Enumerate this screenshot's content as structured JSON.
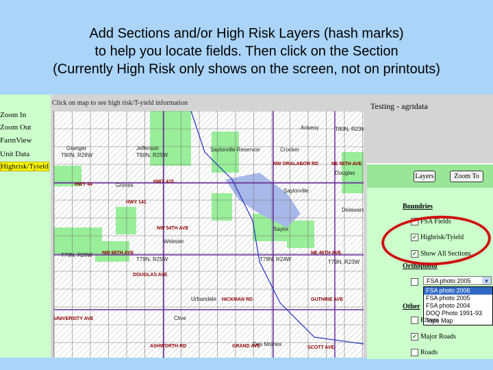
{
  "slide": {
    "title_lines": [
      "Add Sections and/or High Risk Layers (hash marks)",
      "to help you locate fields. Then click on the Section",
      "(Currently High Risk only shows on the screen, not on printouts)"
    ]
  },
  "left_menu": {
    "items": [
      {
        "label": "Zoom In"
      },
      {
        "label": "Zoom Out"
      },
      {
        "label": "FarmView"
      },
      {
        "label": "Unit Data"
      },
      {
        "label": "Highrisk/Tyield",
        "selected": true
      }
    ]
  },
  "map": {
    "header": "Click on map to see high risk/T-yield information",
    "towns": [
      "Ankeny",
      "Granger",
      "T80N, R26W",
      "Jefferson",
      "T80N, R25W",
      "Saylorville Reservoir",
      "Crocker",
      "Douglas",
      "Saylorville",
      "Delaware",
      "Saylor",
      "Webster",
      "T79N, R26W",
      "T79N, R25W",
      "T79N, R24W",
      "T79N, R23W",
      "Urbandale",
      "Clive",
      "Des Moines",
      "Grimes",
      "T80N, R23W"
    ],
    "roads": [
      "NW 54TH AVE",
      "HWY 141",
      "NW 66TH AVE",
      "DOUGLAS AVE",
      "HICKMAN RD",
      "UNIVERSITY AVE",
      "ASHWORTH RD",
      "GRAND AVE",
      "SCOTT AVE",
      "GUTHRIE AVE",
      "NE 46TH AVE",
      "NW ORALABOR RD",
      "NE 56TH AVE",
      "HWY 44",
      "HWY 415"
    ],
    "colors": {
      "park": "#99ee99",
      "water": "#a8b8e8",
      "grid": "#777777",
      "road": "#8b0000"
    }
  },
  "right_panel": {
    "title": "Testing - agridata",
    "buttons": {
      "layers": "Layers",
      "zoom_to": "Zoom To"
    },
    "boundaries": {
      "heading": "Boundries",
      "items": [
        {
          "label": "FSA Fields",
          "checked": false
        },
        {
          "label": "Highrisk/Tyield",
          "checked": true
        },
        {
          "label": "Show All Sections",
          "checked": true
        }
      ]
    },
    "orthophotos": {
      "heading": "Orthophoto",
      "checked": false,
      "selected": "FSA photo 2005",
      "options": [
        "FSA photo 2006",
        "FSA photo 2005",
        "FSA photo 2004",
        "DOQ Photo 1991-93",
        "Topo Map"
      ]
    },
    "other": {
      "heading": "Other",
      "items": [
        {
          "label": "Rivers",
          "checked": false
        },
        {
          "label": "Major Roads",
          "checked": true
        },
        {
          "label": "Roads",
          "checked": false
        }
      ]
    }
  }
}
